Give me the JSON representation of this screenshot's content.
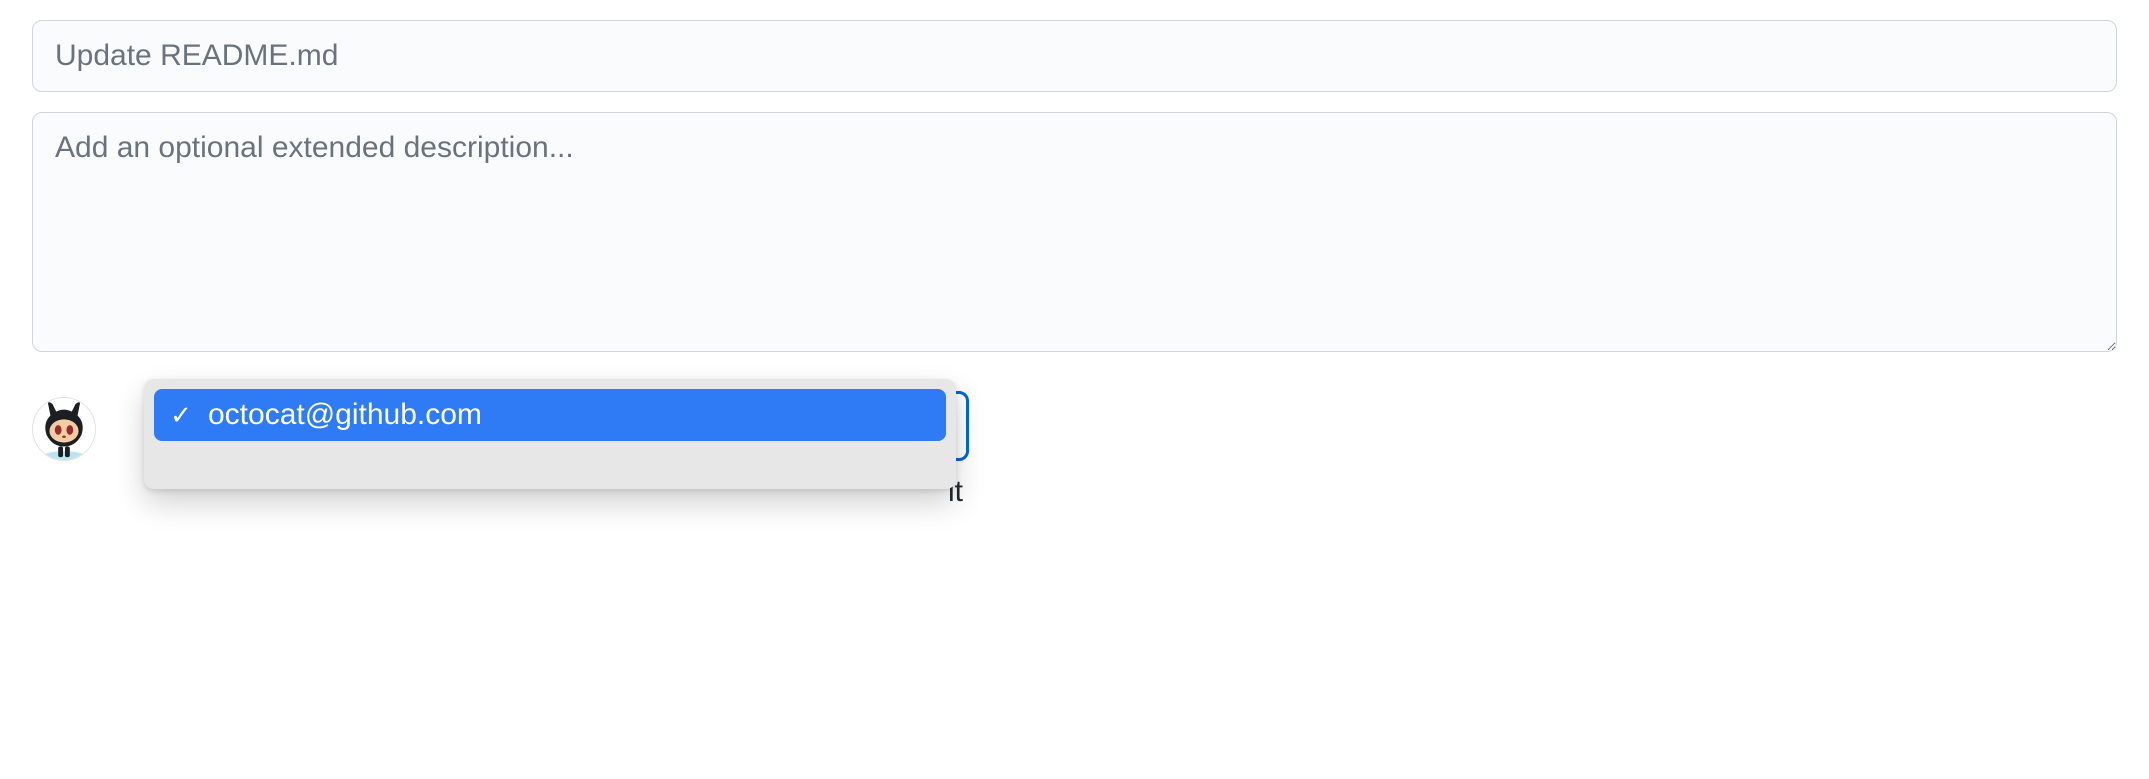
{
  "commit": {
    "summary_placeholder": "Update README.md",
    "description_placeholder": "Add an optional extended description..."
  },
  "author_dropdown": {
    "selected": "octocat@github.com",
    "options": [
      {
        "label": "octocat@github.com",
        "selected": true
      }
    ]
  },
  "truncated_hint": "it",
  "icons": {
    "check": "✓"
  }
}
